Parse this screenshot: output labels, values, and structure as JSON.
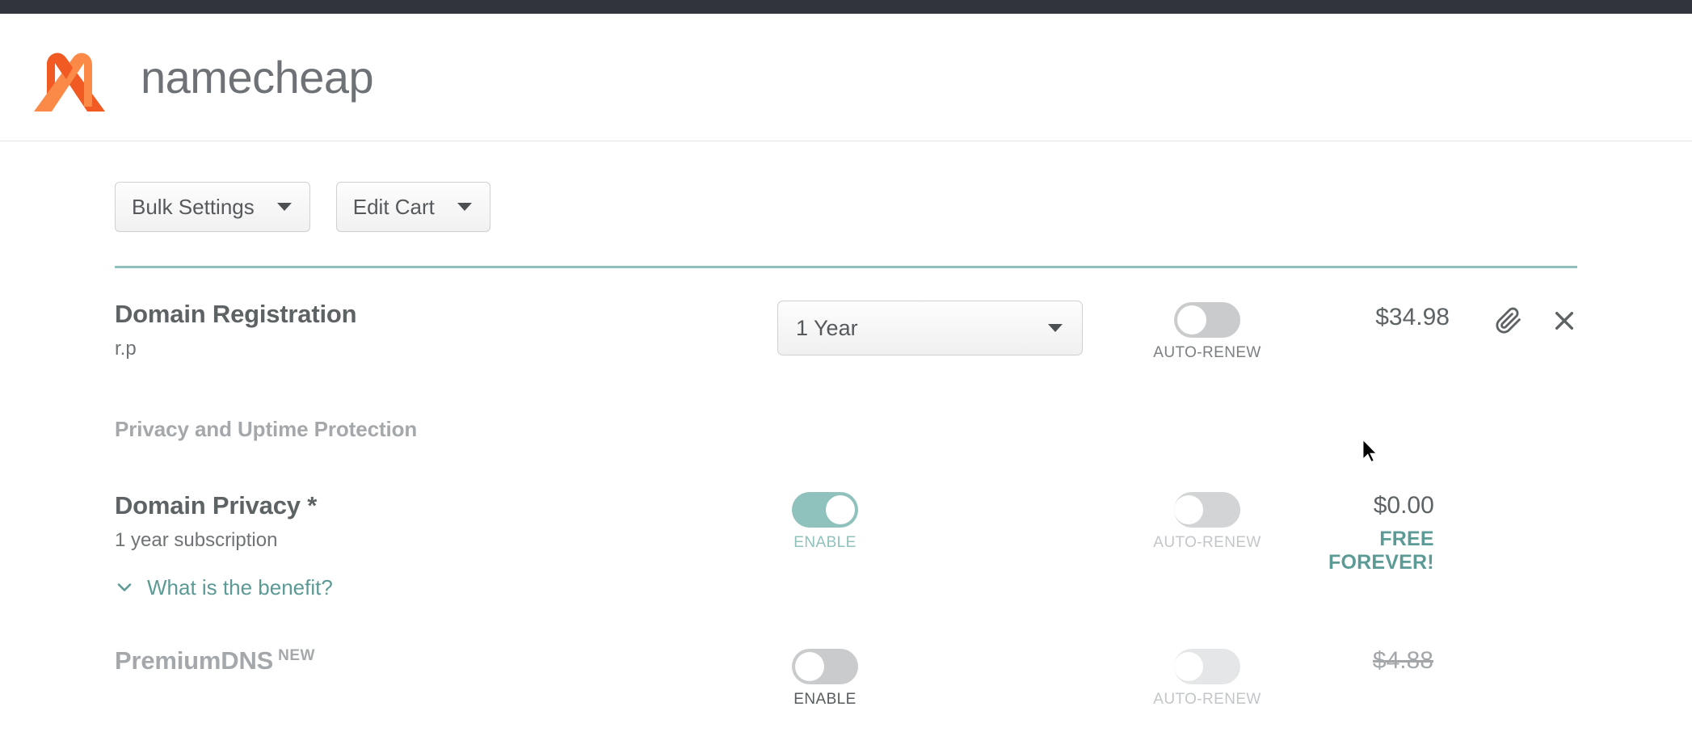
{
  "brand": {
    "name": "namecheap",
    "logo_colors": {
      "dark_orange": "#f15a22",
      "light_orange": "#fb8a48"
    },
    "accent_teal": "#8fc1bd",
    "topbar_color": "#30343a"
  },
  "toolbar": {
    "bulk_settings_label": "Bulk Settings",
    "edit_cart_label": "Edit Cart"
  },
  "cart": {
    "domain_registration": {
      "title": "Domain Registration",
      "domain": "r.p",
      "term_value": "1 Year",
      "auto_renew_label": "AUTO-RENEW",
      "auto_renew_state": "off",
      "price": "$34.98",
      "attach_icon": "paperclip-icon",
      "remove_icon": "close-icon"
    },
    "section_title": "Privacy and Uptime Protection",
    "domain_privacy": {
      "title": "Domain Privacy *",
      "subtitle": "1 year subscription",
      "enable_label": "ENABLE",
      "enable_state": "on",
      "auto_renew_label": "AUTO-RENEW",
      "auto_renew_state": "off",
      "price": "$0.00",
      "price_note": "FREE FOREVER!",
      "benefit_link": "What is the benefit?",
      "benefit_chevron": "chevron-down-icon"
    },
    "premium_dns": {
      "title": "PremiumDNS",
      "badge": "NEW",
      "enable_label": "ENABLE",
      "enable_state": "off",
      "auto_renew_label": "AUTO-RENEW",
      "auto_renew_state": "disabled",
      "price": "$4.88",
      "price_struck": true
    }
  }
}
